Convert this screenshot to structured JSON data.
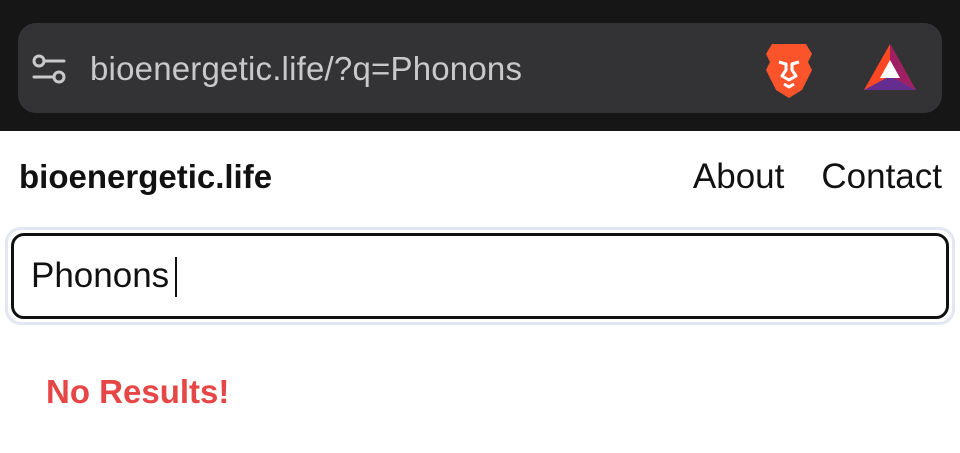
{
  "browser": {
    "url": "bioenergetic.life/?q=Phonons",
    "icons": {
      "site_settings": "tune-icon",
      "shields": "brave-lion-icon",
      "rewards": "bat-triangle-icon"
    },
    "colors": {
      "toolbar_bg": "#161616",
      "url_field_bg": "#333335",
      "url_text": "#c9c9cc",
      "brave_orange": "#fb542b",
      "bat_purple": "#662d91"
    }
  },
  "site": {
    "title": "bioenergetic.life",
    "nav": [
      {
        "label": "About"
      },
      {
        "label": "Contact"
      }
    ]
  },
  "search": {
    "value": "Phonons"
  },
  "results": {
    "message": "No Results!",
    "message_color": "#e64646"
  }
}
